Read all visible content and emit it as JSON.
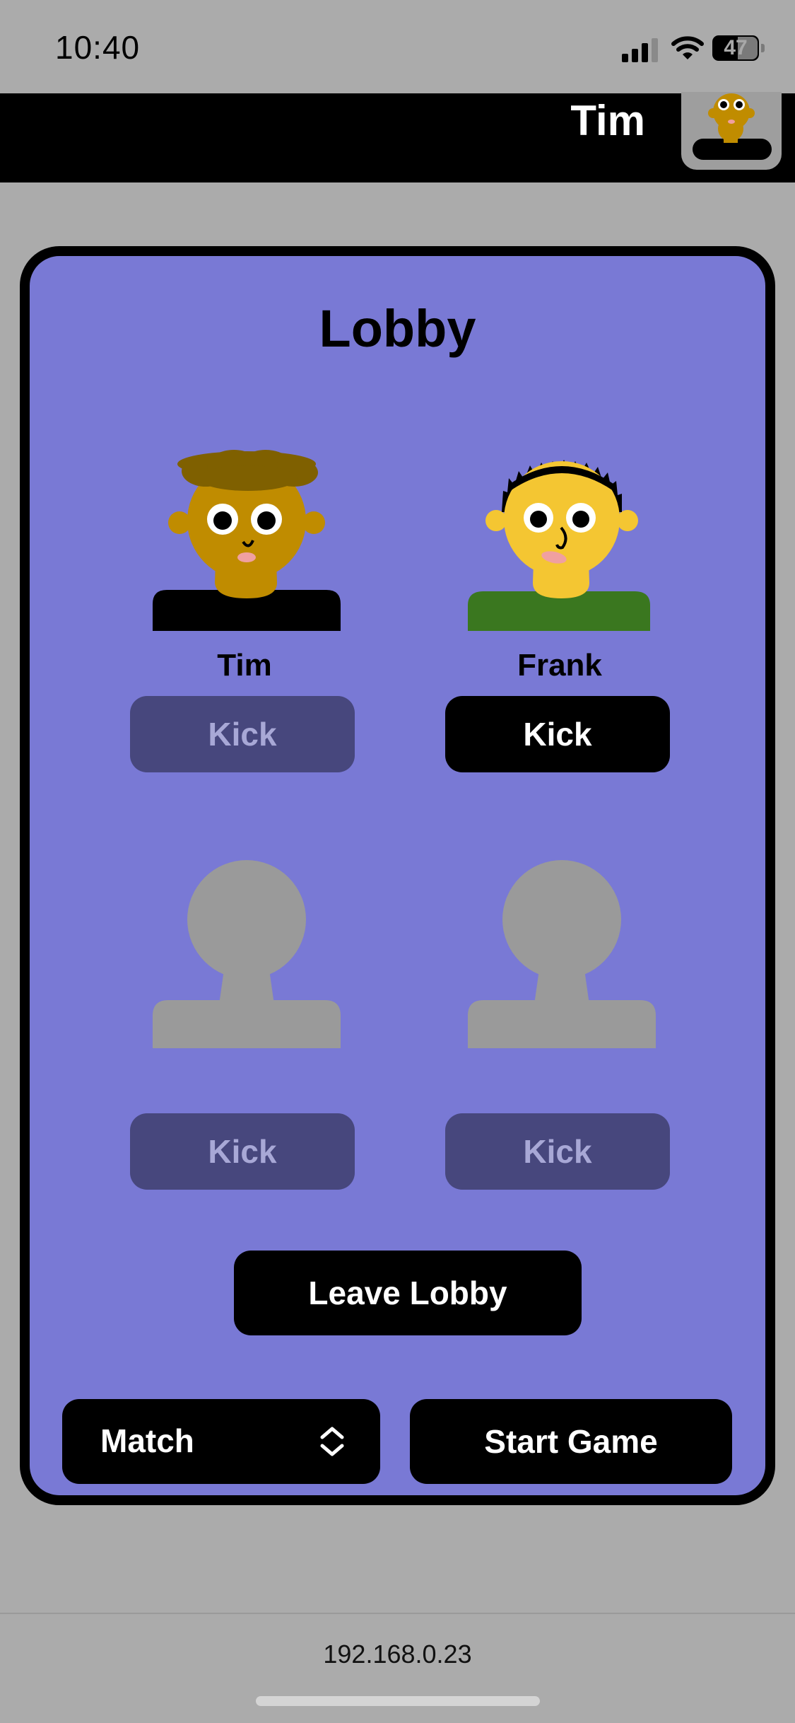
{
  "status_bar": {
    "time": "10:40",
    "battery": "47"
  },
  "header": {
    "user_name": "Tim"
  },
  "lobby": {
    "title": "Lobby",
    "players": [
      {
        "name": "Tim",
        "kick_label": "Kick",
        "kick_enabled": false,
        "avatar": "player-tim-avatar"
      },
      {
        "name": "Frank",
        "kick_label": "Kick",
        "kick_enabled": true,
        "avatar": "player-frank-avatar"
      },
      {
        "name": "",
        "kick_label": "Kick",
        "kick_enabled": false,
        "avatar": "empty-slot-avatar"
      },
      {
        "name": "",
        "kick_label": "Kick",
        "kick_enabled": false,
        "avatar": "empty-slot-avatar"
      }
    ],
    "leave_label": "Leave Lobby",
    "mode_select": {
      "value": "Match"
    },
    "start_label": "Start Game"
  },
  "footer": {
    "address": "192.168.0.23"
  },
  "colors": {
    "card_bg": "#7979d5",
    "disabled_button": "#47477d",
    "page_bg": "#ababab"
  }
}
